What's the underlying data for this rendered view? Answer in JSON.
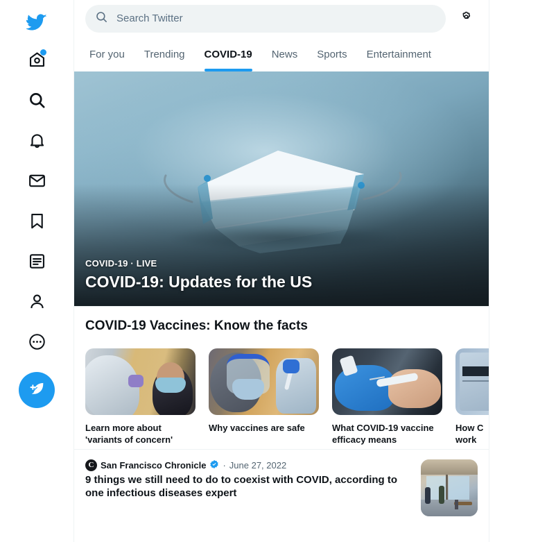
{
  "sidebar": {
    "items": [
      {
        "name": "twitter-logo",
        "label": "Twitter"
      },
      {
        "name": "home",
        "label": "Home",
        "badge": true
      },
      {
        "name": "explore",
        "label": "Explore"
      },
      {
        "name": "notifications",
        "label": "Notifications"
      },
      {
        "name": "messages",
        "label": "Messages"
      },
      {
        "name": "bookmarks",
        "label": "Bookmarks"
      },
      {
        "name": "lists",
        "label": "Lists"
      },
      {
        "name": "profile",
        "label": "Profile"
      },
      {
        "name": "more",
        "label": "More"
      }
    ],
    "compose_label": "Tweet"
  },
  "search": {
    "placeholder": "Search Twitter",
    "value": "",
    "icon": "search-icon"
  },
  "settings": {
    "icon": "gear-icon",
    "label": "Explore settings"
  },
  "tabs": [
    {
      "label": "For you",
      "active": false
    },
    {
      "label": "Trending",
      "active": false
    },
    {
      "label": "COVID-19",
      "active": true
    },
    {
      "label": "News",
      "active": false
    },
    {
      "label": "Sports",
      "active": false
    },
    {
      "label": "Entertainment",
      "active": false
    }
  ],
  "hero": {
    "kicker": "COVID-19 · LIVE",
    "title": "COVID-19: Updates for the US",
    "image_alt": "surgical-face-mask"
  },
  "vaccine_section": {
    "title": "COVID-19 Vaccines: Know the facts",
    "cards": [
      {
        "label": "Learn more about 'variants of concern'",
        "image_alt": "covid-swab-test"
      },
      {
        "label": "Why vaccines are safe",
        "image_alt": "nurse-preparing-vaccine"
      },
      {
        "label": "What COVID-19 vaccine efficacy means",
        "image_alt": "gloved-hand-syringe"
      },
      {
        "label": "How C",
        "label2": "work",
        "image_alt": "vaccine-freezer"
      }
    ]
  },
  "news": {
    "source": "San Francisco Chronicle",
    "source_initial": "C",
    "verified": true,
    "separator": "·",
    "date": "June 27, 2022",
    "headline": "9 things we still need to do to coexist with COVID, according to one infectious diseases expert",
    "thumb_alt": "cafe-storefront-interior"
  },
  "colors": {
    "brand_blue": "#1d9bf0",
    "text_primary": "#0f1419",
    "text_secondary": "#536471",
    "divider": "#eff3f4",
    "search_bg": "#eff3f4"
  }
}
